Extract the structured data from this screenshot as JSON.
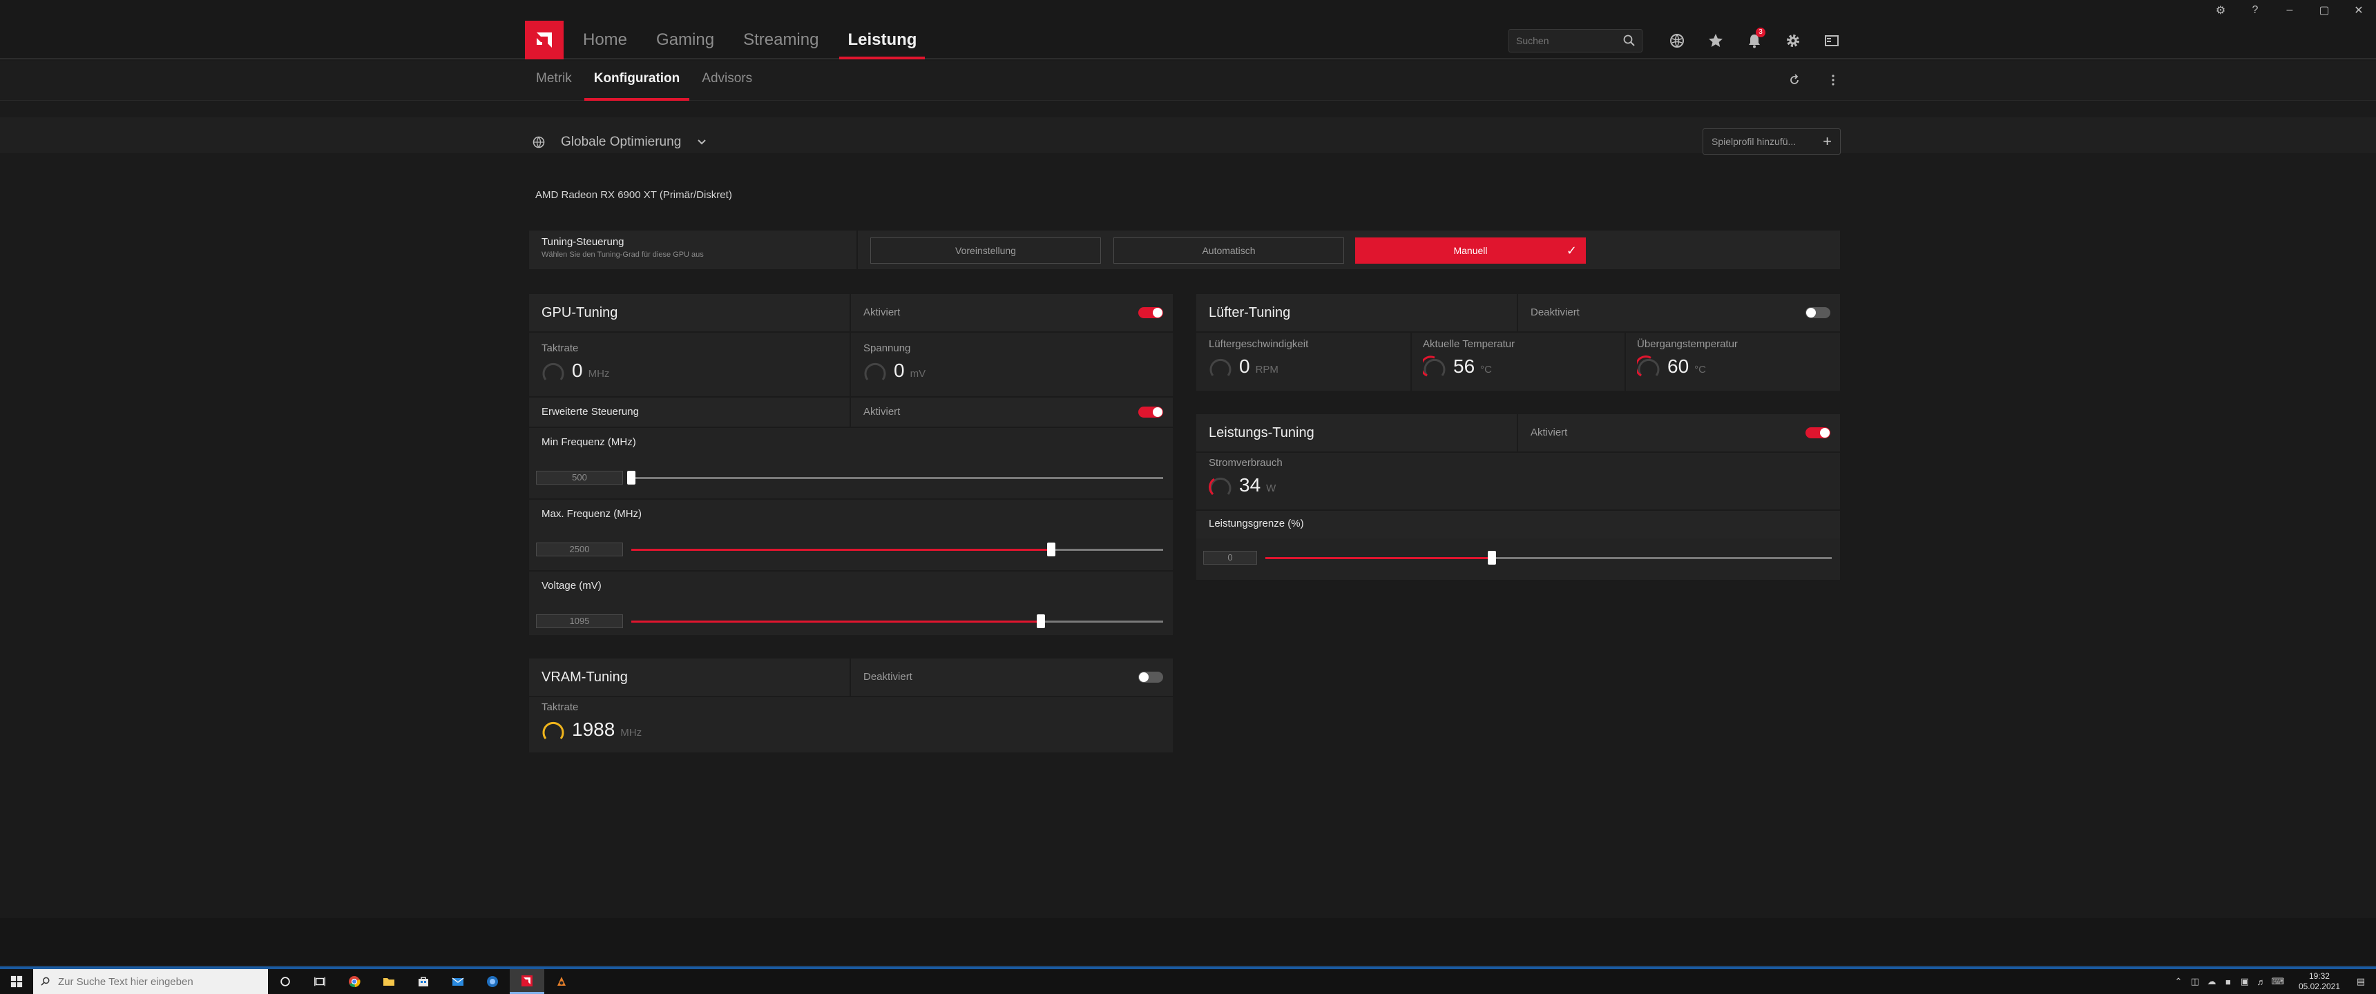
{
  "window": {
    "controls": [
      "⚙",
      "?",
      "–",
      "▢",
      "✕"
    ]
  },
  "nav": {
    "items": [
      "Home",
      "Gaming",
      "Streaming",
      "Leistung"
    ],
    "active": 3
  },
  "search": {
    "placeholder": "Suchen"
  },
  "notifications": {
    "count": "3"
  },
  "subnav": {
    "items": [
      "Metrik",
      "Konfiguration",
      "Advisors"
    ],
    "active": 1
  },
  "profile": {
    "label": "Globale Optimierung",
    "add_label": "Spielprofil hinzufü..."
  },
  "gpu": {
    "name": "AMD Radeon RX 6900 XT (Primär/Diskret)"
  },
  "tuning_control": {
    "title": "Tuning-Steuerung",
    "subtitle": "Wählen Sie den Tuning-Grad für diese GPU aus",
    "options": [
      "Voreinstellung",
      "Automatisch",
      "Manuell"
    ],
    "selected": 2
  },
  "gpu_tuning": {
    "title": "GPU-Tuning",
    "state": "Aktiviert",
    "enabled": true,
    "clock": {
      "label": "Taktrate",
      "value": "0",
      "unit": "MHz"
    },
    "voltage": {
      "label": "Spannung",
      "value": "0",
      "unit": "mV"
    },
    "advanced": {
      "label": "Erweiterte Steuerung",
      "state": "Aktiviert",
      "enabled": true
    },
    "min_freq": {
      "label": "Min Frequenz (MHz)",
      "value": "500",
      "fraction": 0.0
    },
    "max_freq": {
      "label": "Max. Frequenz (MHz)",
      "value": "2500",
      "fraction": 0.79
    },
    "voltage_slider": {
      "label": "Voltage (mV)",
      "value": "1095",
      "fraction": 0.77
    }
  },
  "vram_tuning": {
    "title": "VRAM-Tuning",
    "state": "Deaktiviert",
    "enabled": false,
    "clock": {
      "label": "Taktrate",
      "value": "1988",
      "unit": "MHz"
    }
  },
  "fan_tuning": {
    "title": "Lüfter-Tuning",
    "state": "Deaktiviert",
    "enabled": false,
    "fan_speed": {
      "label": "Lüftergeschwindigkeit",
      "value": "0",
      "unit": "RPM"
    },
    "current_temp": {
      "label": "Aktuelle Temperatur",
      "value": "56",
      "unit": "°C"
    },
    "junction_temp": {
      "label": "Übergangstemperatur",
      "value": "60",
      "unit": "°C"
    }
  },
  "power_tuning": {
    "title": "Leistungs-Tuning",
    "state": "Aktiviert",
    "enabled": true,
    "power": {
      "label": "Stromverbrauch",
      "value": "34",
      "unit": "W"
    },
    "limit": {
      "label": "Leistungsgrenze (%)",
      "value": "0",
      "fraction": 0.4
    }
  },
  "taskbar": {
    "search_placeholder": "Zur Suche Text hier eingeben",
    "time": "19:32",
    "date": "05.02.2021"
  },
  "colors": {
    "accent": "#e0152e",
    "gauge_yellow": "#f0b51c",
    "background": "#1b1b1b",
    "panel": "#232323"
  }
}
